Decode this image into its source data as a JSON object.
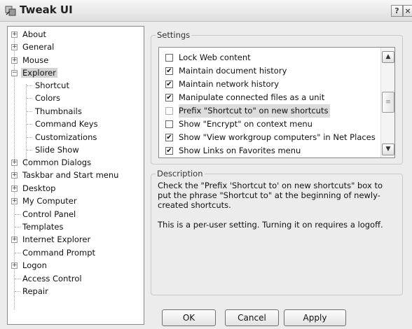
{
  "window": {
    "title": "Tweak UI"
  },
  "titlebar": {
    "help_label": "?",
    "close_label": "×"
  },
  "tree": {
    "items": [
      {
        "label": "About",
        "toggle": "+"
      },
      {
        "label": "General",
        "toggle": "+"
      },
      {
        "label": "Mouse",
        "toggle": "+"
      },
      {
        "label": "Explorer",
        "toggle": "−",
        "selected": true
      },
      {
        "label": "Shortcut"
      },
      {
        "label": "Colors"
      },
      {
        "label": "Thumbnails"
      },
      {
        "label": "Command Keys"
      },
      {
        "label": "Customizations"
      },
      {
        "label": "Slide Show"
      },
      {
        "label": "Common Dialogs",
        "toggle": "+"
      },
      {
        "label": "Taskbar and Start menu",
        "toggle": "+"
      },
      {
        "label": "Desktop",
        "toggle": "+"
      },
      {
        "label": "My Computer",
        "toggle": "+"
      },
      {
        "label": "Control Panel"
      },
      {
        "label": "Templates"
      },
      {
        "label": "Internet Explorer",
        "toggle": "+"
      },
      {
        "label": "Command Prompt"
      },
      {
        "label": "Logon",
        "toggle": "+"
      },
      {
        "label": "Access Control"
      },
      {
        "label": "Repair"
      }
    ]
  },
  "settings": {
    "legend": "Settings",
    "items": [
      {
        "label": "Lock Web content",
        "checked": false
      },
      {
        "label": "Maintain document history",
        "checked": true
      },
      {
        "label": "Maintain network history",
        "checked": true
      },
      {
        "label": "Manipulate connected files as a unit",
        "checked": true
      },
      {
        "label": "Prefix \"Shortcut to\" on new shortcuts",
        "checked": false,
        "highlighted": true
      },
      {
        "label": "Show \"Encrypt\" on context menu",
        "checked": false
      },
      {
        "label": "Show \"View workgroup computers\" in Net Places",
        "checked": true
      },
      {
        "label": "Show Links on Favorites menu",
        "checked": true
      }
    ],
    "scroll_up": "▲",
    "scroll_down": "▼",
    "thumb_grip": "≡"
  },
  "description": {
    "legend": "Description",
    "para1": "Check the \"Prefix 'Shortcut to' on new shortcuts\" box to put the phrase \"Shortcut to\" at the beginning of newly-created shortcuts.",
    "para2": "This is a per-user setting.  Turning it on requires a logoff."
  },
  "buttons": {
    "ok": "OK",
    "cancel": "Cancel",
    "apply": "Apply"
  },
  "check_mark": "✔"
}
